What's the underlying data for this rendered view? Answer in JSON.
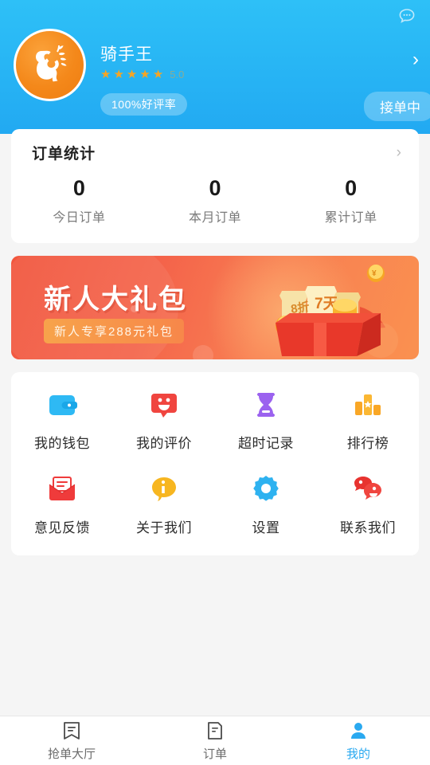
{
  "theme": {
    "header_blue": "#29b8f5",
    "accent_blue": "#2aa9f0",
    "page_bg": "#f5f5f5",
    "banner_red": "#f4634a",
    "star_orange": "#f5a524"
  },
  "header": {
    "chat_icon": "chat-bubble-dots-icon",
    "avatar_icon": "squirrel-mascot-avatar",
    "name": "骑手王",
    "rating_value": "5.0",
    "stars_filled": 5,
    "star_glyph": "★",
    "praise_badge": "100%好评率",
    "status_pill": "接单中",
    "chevron": "›"
  },
  "stats": {
    "title": "订单统计",
    "chevron": "›",
    "items": [
      {
        "value": "0",
        "label": "今日订单"
      },
      {
        "value": "0",
        "label": "本月订单"
      },
      {
        "value": "0",
        "label": "累计订单"
      }
    ]
  },
  "banner": {
    "title": "新人大礼包",
    "subtitle": "新人专享288元礼包",
    "coupon_1": "8折",
    "coupon_2": "7天",
    "coin_symbol": "¥",
    "illustration": "gift-box-with-coupons-and-coins"
  },
  "menu": {
    "rows": [
      [
        {
          "label": "我的钱包",
          "icon": "wallet-icon",
          "color": "#2eb9f4"
        },
        {
          "label": "我的评价",
          "icon": "smiley-review-icon",
          "color": "#f0453f"
        },
        {
          "label": "超时记录",
          "icon": "hourglass-icon",
          "color": "#9b62ef"
        },
        {
          "label": "排行榜",
          "icon": "bar-chart-rank-icon",
          "color": "#f9a726"
        }
      ],
      [
        {
          "label": "意见反馈",
          "icon": "feedback-envelope-icon",
          "color": "#ef3b3b"
        },
        {
          "label": "关于我们",
          "icon": "info-bubble-icon",
          "color": "#f7b620"
        },
        {
          "label": "设置",
          "icon": "gear-icon",
          "color": "#2eb2f0"
        },
        {
          "label": "联系我们",
          "icon": "contact-bubbles-icon",
          "color": "#ef3b4b"
        }
      ]
    ]
  },
  "tabbar": {
    "tabs": [
      {
        "label": "抢单大厅",
        "icon": "bookmark-list-icon",
        "active": false
      },
      {
        "label": "订单",
        "icon": "order-document-icon",
        "active": false
      },
      {
        "label": "我的",
        "icon": "person-icon",
        "active": true
      }
    ]
  }
}
